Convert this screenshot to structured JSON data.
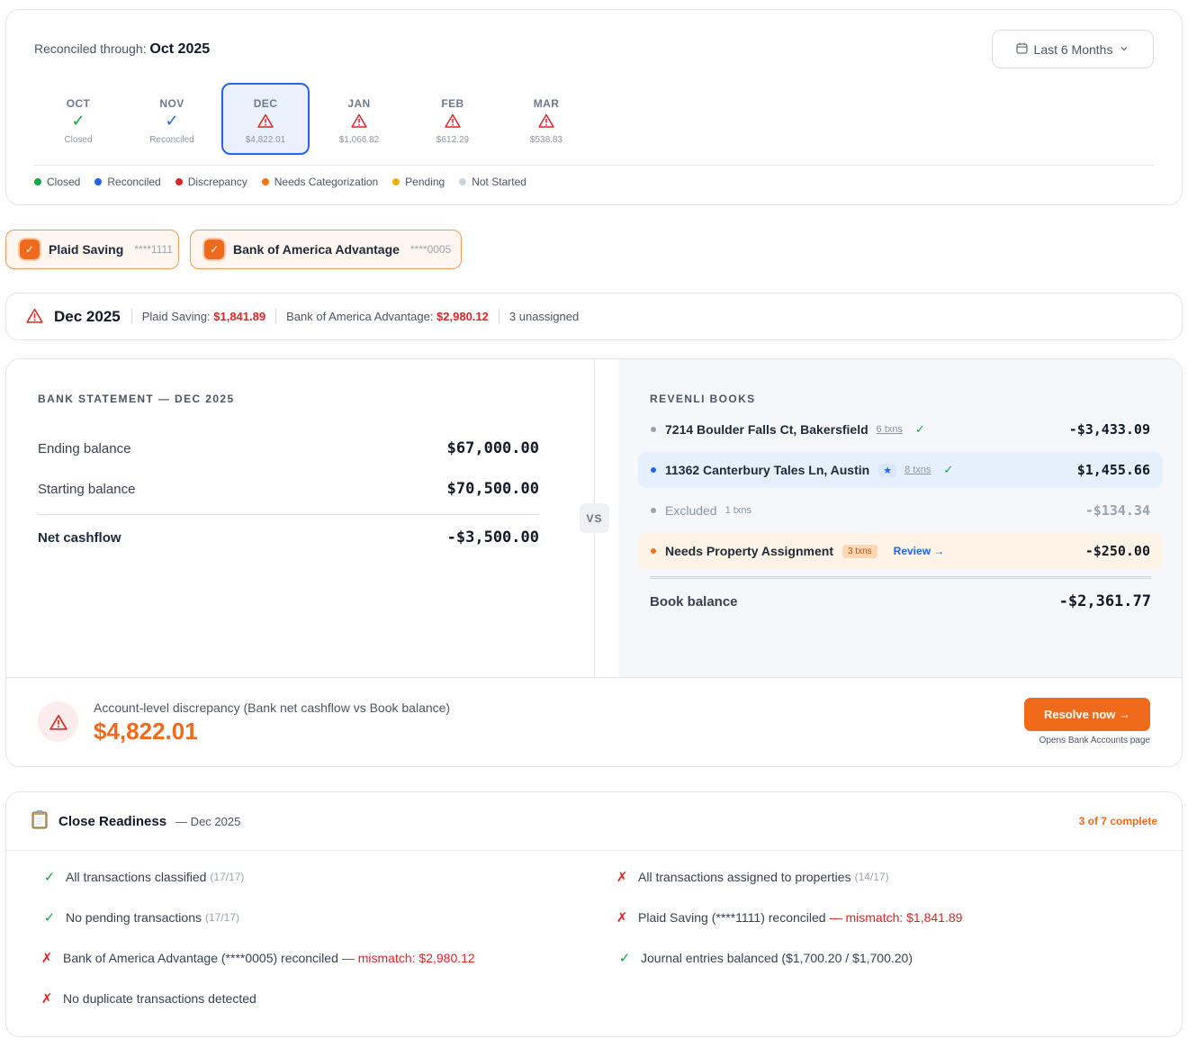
{
  "header": {
    "reconciled_label": "Reconciled through:",
    "reconciled_month": "Oct 2025",
    "range_label": "Last 6 Months"
  },
  "months": [
    {
      "name": "OCT",
      "sub": "Closed",
      "status": "closed"
    },
    {
      "name": "NOV",
      "sub": "Reconciled",
      "status": "reconciled"
    },
    {
      "name": "DEC",
      "sub": "$4,822.01",
      "status": "discrepancy"
    },
    {
      "name": "JAN",
      "sub": "$1,066.82",
      "status": "discrepancy"
    },
    {
      "name": "FEB",
      "sub": "$612.29",
      "status": "discrepancy"
    },
    {
      "name": "MAR",
      "sub": "$538.83",
      "status": "discrepancy"
    }
  ],
  "legend": [
    {
      "label": "Closed",
      "color": "#16a34a"
    },
    {
      "label": "Reconciled",
      "color": "#2563eb"
    },
    {
      "label": "Discrepancy",
      "color": "#dc2626"
    },
    {
      "label": "Needs Categorization",
      "color": "#f97316"
    },
    {
      "label": "Pending",
      "color": "#eab308"
    },
    {
      "label": "Not Started",
      "color": "#cbd5e1"
    }
  ],
  "accounts": [
    {
      "name": "Plaid Saving",
      "mask": "****1111",
      "checked": true
    },
    {
      "name": "Bank of America Advantage",
      "mask": "****0005",
      "checked": true
    }
  ],
  "summary": {
    "title": "Dec 2025",
    "acct1_label": "Plaid Saving:",
    "acct1_value": "$1,841.89",
    "acct2_label": "Bank of America Advantage:",
    "acct2_value": "$2,980.12",
    "unassigned": "3 unassigned"
  },
  "bank": {
    "heading": "BANK STATEMENT — DEC 2025",
    "ending_label": "Ending balance",
    "ending_value": "$67,000.00",
    "starting_label": "Starting balance",
    "starting_value": "$70,500.00",
    "net_label": "Net cashflow",
    "net_value": "-$3,500.00"
  },
  "vs_label": "VS",
  "books": {
    "heading": "REVENLI BOOKS",
    "rows": [
      {
        "name": "7214 Boulder Falls Ct, Bakersfield",
        "txns": "6 txns",
        "amount": "-$3,433.09"
      },
      {
        "name": "11362 Canterbury Tales Ln, Austin",
        "badge": "★",
        "txns": "8 txns",
        "amount": "$1,455.66"
      },
      {
        "name": "Excluded",
        "txns": "1 txns",
        "amount": "-$134.34"
      },
      {
        "name": "Needs Property Assignment",
        "badge": "3 txns",
        "link": "Review →",
        "amount": "-$250.00"
      }
    ],
    "balance_label": "Book balance",
    "balance_value": "-$2,361.77"
  },
  "discrepancy": {
    "title": "Account-level discrepancy (Bank net cashflow vs Book balance)",
    "amount": "$4,822.01",
    "button": "Resolve now →",
    "note": "Opens Bank Accounts page"
  },
  "readiness": {
    "title": "Close Readiness",
    "subtitle": "— Dec 2025",
    "count": "3 of 7 complete",
    "items": [
      {
        "label": "All transactions classified",
        "detail": "(17/17)",
        "ok": true
      },
      {
        "label": "All transactions assigned to properties",
        "detail": "(14/17)",
        "ok": false
      },
      {
        "label": "No pending transactions",
        "detail": "(17/17)",
        "ok": true
      },
      {
        "label": "Plaid Saving (****1111) reconciled",
        "mismatch": "— mismatch: $1,841.89",
        "ok": false
      },
      {
        "label": "Bank of America Advantage (****0005) reconciled",
        "mismatch": "— mismatch: $2,980.12",
        "ok": false
      },
      {
        "label": "Journal entries balanced ($1,700.20 / $1,700.20)",
        "ok": true
      },
      {
        "label": "No duplicate transactions detected",
        "ok": false
      }
    ]
  }
}
